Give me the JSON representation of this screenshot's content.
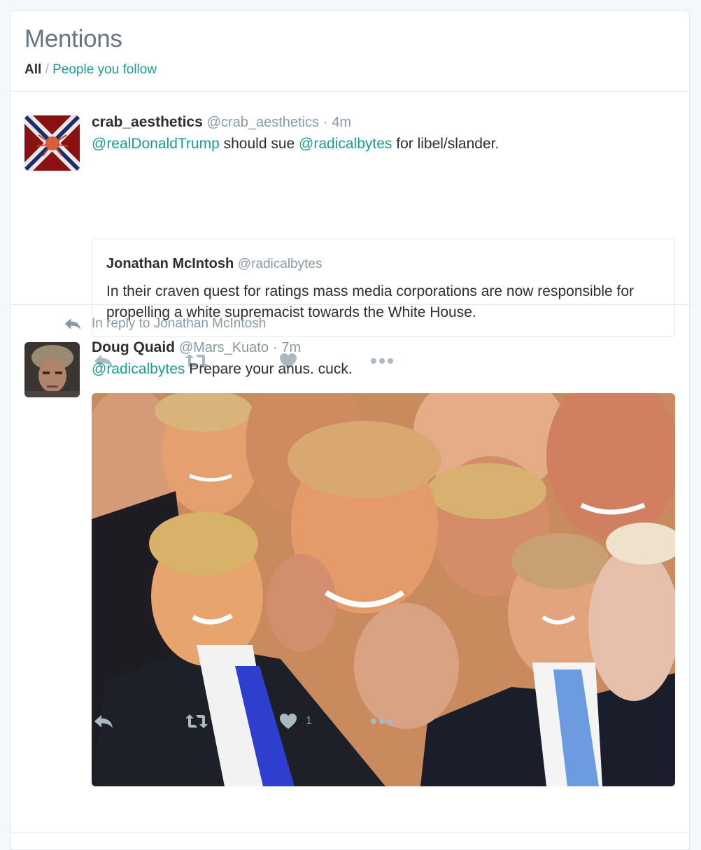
{
  "header": {
    "title": "Mentions",
    "filter_all": "All",
    "filter_separator": "/",
    "filter_following": "People you follow"
  },
  "tweets": [
    {
      "name": "crab_aesthetics",
      "handle": "@crab_aesthetics",
      "dot": "·",
      "time": "4m",
      "text_parts": [
        "@realDonaldTrump",
        " should sue ",
        "@radicalbytes",
        " for libel/slander."
      ],
      "quote": {
        "name": "Jonathan McIntosh",
        "handle": "@radicalbytes",
        "text": "In their craven quest for ratings mass media corporations are now responsible for propelling a white supremacist towards the White House."
      },
      "like_count": ""
    },
    {
      "reply_context": "In reply to Jonathan McIntosh",
      "name": "Doug Quaid",
      "handle": "@Mars_Kuato",
      "dot": "·",
      "time": "7m",
      "text_parts": [
        "@radicalbytes",
        " Prepare your anus. cuck."
      ],
      "like_count": "1"
    }
  ],
  "icons": {
    "reply": "reply-icon",
    "retweet": "retweet-icon",
    "like": "heart-icon",
    "more": "more-icon"
  },
  "colors": {
    "accent": "#1b9c95",
    "muted": "#8899a6",
    "icon": "#aab8c2",
    "border": "#e1e8ed"
  }
}
